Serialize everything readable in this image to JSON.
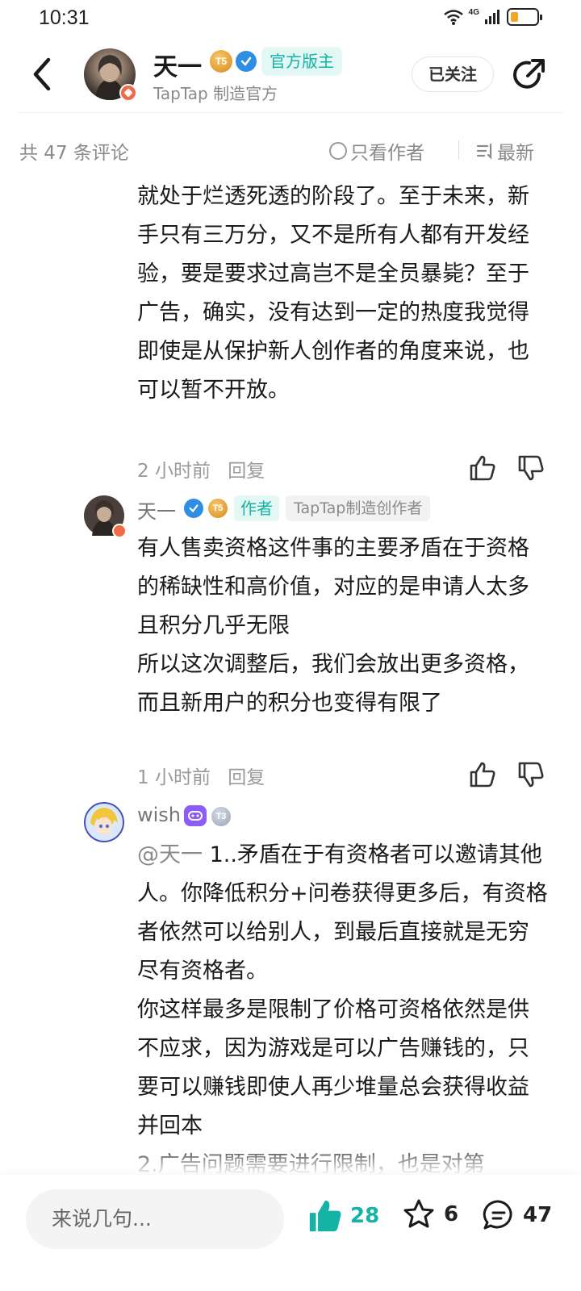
{
  "status_bar": {
    "time": "10:31",
    "network": "4G",
    "battery_level": 0.3
  },
  "header": {
    "author_name": "天一",
    "level_badge": "T5",
    "official_tag": "官方版主",
    "subtitle": "TapTap 制造官方",
    "follow_label": "已关注"
  },
  "filter": {
    "comment_count": "共 47 条评论",
    "only_author": "只看作者",
    "sort": "最新"
  },
  "comments": [
    {
      "text": "就处于烂透死透的阶段了。至于未来，新手只有三万分，又不是所有人都有开发经验，要是要求过高岂不是全员暴毙？至于广告，确实，没有达到一定的热度我觉得即使是从保护新人创作者的角度来说，也可以暂不开放。",
      "time": "2 小时前",
      "reply_label": "回复"
    },
    {
      "name": "天一",
      "level_badge": "T5",
      "author_tag": "作者",
      "creator_tag": "TapTap制造创作者",
      "text": "有人售卖资格这件事的主要矛盾在于资格的稀缺性和高价值，对应的是申请人太多且积分几乎无限\n所以这次调整后，我们会放出更多资格，而且新用户的积分也变得有限了",
      "time": "1 小时前",
      "reply_label": "回复"
    },
    {
      "name": "wish",
      "level_badge": "T3",
      "mention": "@天一",
      "text": "  1..矛盾在于有资格者可以邀请其他人。你降低积分+问卷获得更多后，有资格者依然可以给别人，到最后直接就是无穷尽有资格者。\n你这样最多是限制了价格可资格依然是供不应求，因为游戏是可以广告赚钱的，只要可以赚钱即使人再少堆量总会获得收益并回本\n2.广告问题需要进行限制，也是对第"
    }
  ],
  "bottom_bar": {
    "input_placeholder": "来说几句...",
    "like_count": "28",
    "favorite_count": "6",
    "comment_count": "47"
  },
  "colors": {
    "accent": "#14b3a5",
    "verify_blue": "#2f8de4",
    "level_gold": "#e0a23a",
    "level_gray": "#a9b4c2"
  }
}
